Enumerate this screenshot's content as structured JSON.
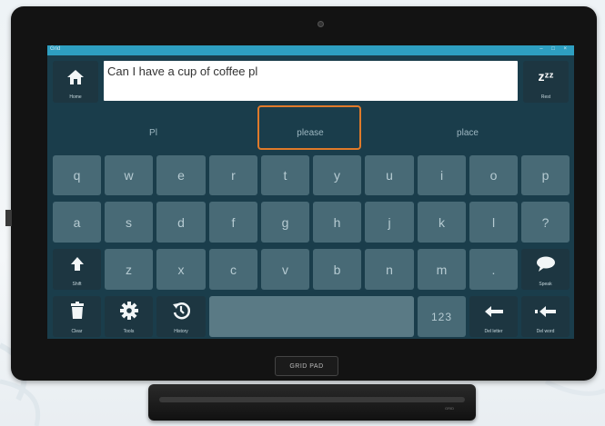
{
  "app": {
    "title": "Grid",
    "window_controls": "– □ ×"
  },
  "message_text": "Can I have a cup of coffee pl",
  "home_key": {
    "label": "Home",
    "icon": "home-icon"
  },
  "rest_key": {
    "label": "Rest",
    "glyph": "zᶻᶻ",
    "icon": "sleep-icon"
  },
  "predictions": [
    "Pl",
    "please",
    "place"
  ],
  "rows": [
    [
      "q",
      "w",
      "e",
      "r",
      "t",
      "y",
      "u",
      "i",
      "o",
      "p"
    ],
    [
      "a",
      "s",
      "d",
      "f",
      "g",
      "h",
      "j",
      "k",
      "l",
      "?"
    ],
    [
      "z",
      "x",
      "c",
      "v",
      "b",
      "n",
      "m",
      "."
    ]
  ],
  "shift_key": {
    "label": "Shift",
    "icon": "shift-arrow-icon"
  },
  "speak_key": {
    "label": "Speak",
    "icon": "speech-bubble-icon"
  },
  "clear_key": {
    "label": "Clear",
    "icon": "trash-icon"
  },
  "tools_key": {
    "label": "Tools",
    "icon": "gear-icon"
  },
  "history_key": {
    "label": "History",
    "icon": "history-icon"
  },
  "numbers_key": {
    "label": "123"
  },
  "delete_letter_key": {
    "label": "Del letter",
    "icon": "backspace-arrow-icon"
  },
  "delete_word_key": {
    "label": "Del word",
    "icon": "delete-word-arrow-icon"
  },
  "bezel_logo": "GRID PAD",
  "speaker_brand": "GRID"
}
